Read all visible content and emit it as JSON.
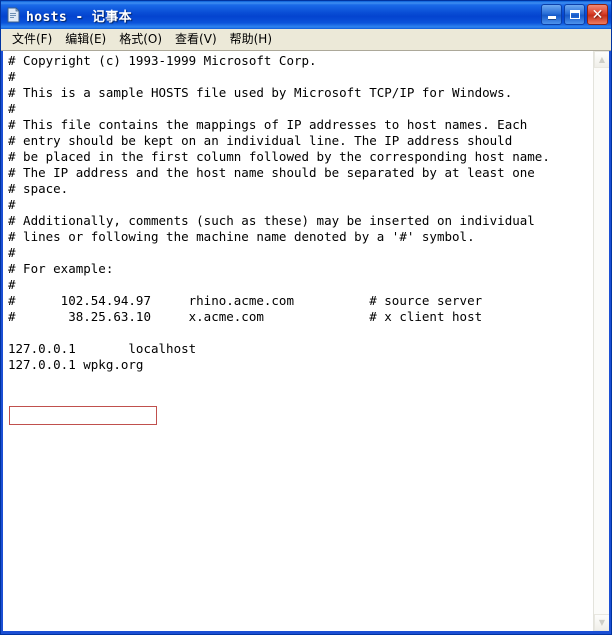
{
  "window": {
    "title": "hosts - 记事本",
    "icon": "notepad-document-icon",
    "buttons": {
      "minimize_label": "_",
      "maximize_label": "□",
      "close_label": "✕"
    },
    "colors": {
      "titlebar_blue": "#0a4fd6",
      "menubar_beige": "#ece9d8",
      "frame_blue": "#1b4fd4",
      "close_red": "#d9402a",
      "highlight_red": "#c0504d"
    }
  },
  "menu": {
    "items": [
      {
        "label": "文件(F)"
      },
      {
        "label": "编辑(E)"
      },
      {
        "label": "格式(O)"
      },
      {
        "label": "查看(V)"
      },
      {
        "label": "帮助(H)"
      }
    ]
  },
  "editor": {
    "lines": [
      "# Copyright (c) 1993-1999 Microsoft Corp.",
      "#",
      "# This is a sample HOSTS file used by Microsoft TCP/IP for Windows.",
      "#",
      "# This file contains the mappings of IP addresses to host names. Each",
      "# entry should be kept on an individual line. The IP address should",
      "# be placed in the first column followed by the corresponding host name.",
      "# The IP address and the host name should be separated by at least one",
      "# space.",
      "#",
      "# Additionally, comments (such as these) may be inserted on individual",
      "# lines or following the machine name denoted by a '#' symbol.",
      "#",
      "# For example:",
      "#",
      "#      102.54.94.97     rhino.acme.com          # source server",
      "#       38.25.63.10     x.acme.com              # x client host",
      "",
      "127.0.0.1       localhost",
      "127.0.0.1 wpkg.org"
    ],
    "highlighted_line": "127.0.0.1 wpkg.org",
    "highlight_line_index": 19
  },
  "scrollbar": {
    "up_arrow_label": "▲",
    "down_arrow_label": "▼",
    "orientation": "vertical"
  }
}
